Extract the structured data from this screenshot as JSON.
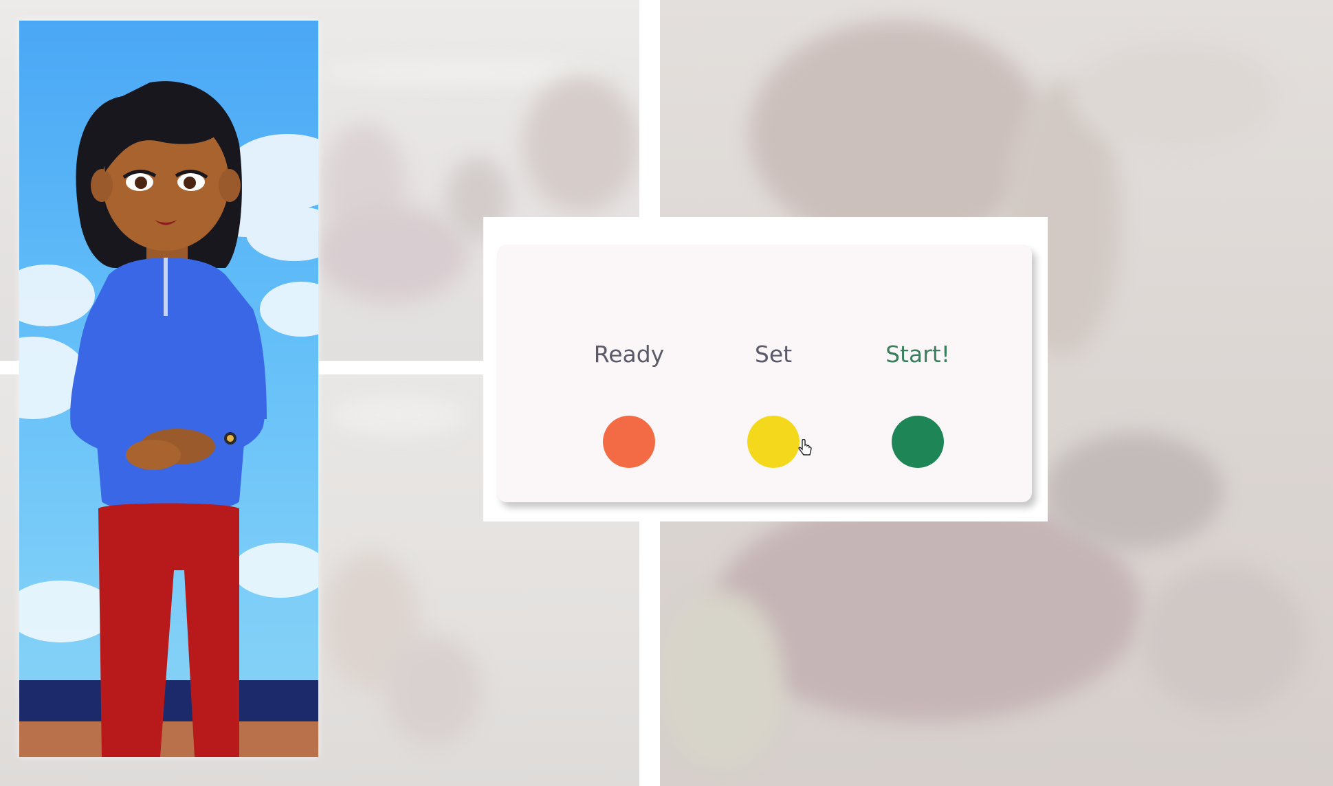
{
  "traffic_light": {
    "ready_label": "Ready",
    "set_label": "Set",
    "start_label": "Start!",
    "colors": {
      "ready": "#f26b45",
      "set": "#f4d81c",
      "start": "#1e8557"
    }
  },
  "icons": {
    "cursor": "hand-pointer-icon"
  }
}
